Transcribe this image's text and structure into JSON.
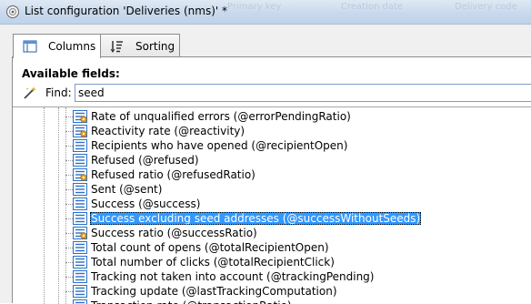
{
  "window": {
    "title": "List configuration 'Deliveries (nms)' *",
    "background_ghost": [
      "Primary key",
      "Creation date",
      "Delivery code"
    ]
  },
  "tabs": [
    {
      "label": "Columns",
      "icon": "list-columns-icon",
      "active": true
    },
    {
      "label": "Sorting",
      "icon": "sort-icon",
      "active": false
    }
  ],
  "fields": {
    "label": "Available fields:",
    "find_label": "Find:",
    "find_value": "seed"
  },
  "tree_items": [
    {
      "label": "Rate of unqualified errors (@errorPendingRatio)",
      "icon": "calculated-field-icon",
      "selected": false
    },
    {
      "label": "Reactivity rate (@reactivity)",
      "icon": "calculated-field-icon",
      "selected": false
    },
    {
      "label": "Recipients who have opened (@recipientOpen)",
      "icon": "field-icon",
      "selected": false
    },
    {
      "label": "Refused (@refused)",
      "icon": "field-icon",
      "selected": false
    },
    {
      "label": "Refused ratio (@refusedRatio)",
      "icon": "calculated-field-icon",
      "selected": false
    },
    {
      "label": "Sent (@sent)",
      "icon": "field-icon",
      "selected": false
    },
    {
      "label": "Success (@success)",
      "icon": "field-icon",
      "selected": false
    },
    {
      "label": "Success excluding seed addresses (@successWithoutSeeds)",
      "icon": "field-icon",
      "selected": true
    },
    {
      "label": "Success ratio (@successRatio)",
      "icon": "calculated-field-icon",
      "selected": false
    },
    {
      "label": "Total count of opens (@totalRecipientOpen)",
      "icon": "field-icon",
      "selected": false
    },
    {
      "label": "Total number of clicks (@totalRecipientClick)",
      "icon": "field-icon",
      "selected": false
    },
    {
      "label": "Tracking not taken into account (@trackingPending)",
      "icon": "field-icon",
      "selected": false
    },
    {
      "label": "Tracking update (@lastTrackingComputation)",
      "icon": "field-icon",
      "selected": false
    },
    {
      "label": "Transaction rate (@transactionRatio)",
      "icon": "calculated-field-icon",
      "selected": false
    }
  ],
  "colors": {
    "selection": "#3399ff",
    "titlebar": "#c9d9ec",
    "icon_blue": "#2a6fc9",
    "gear_orange": "#e8a020"
  }
}
